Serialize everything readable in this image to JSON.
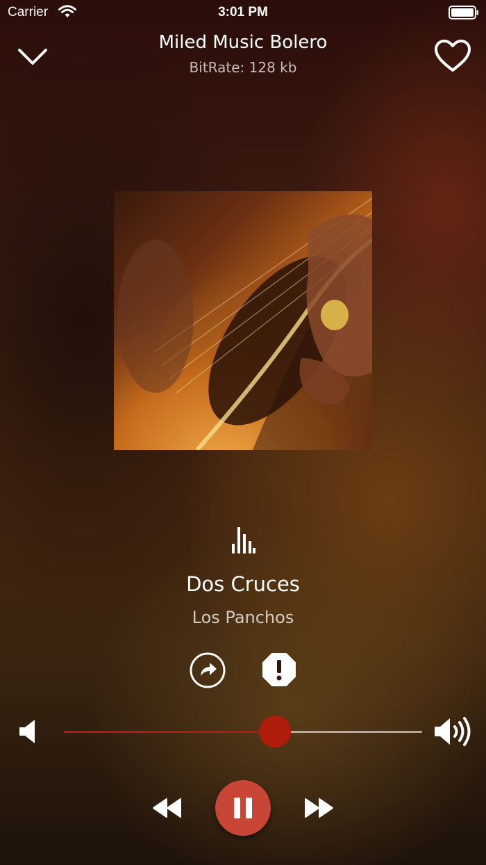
{
  "status_bar": {
    "carrier": "Carrier",
    "time": "3:01 PM",
    "icons": [
      "wifi-icon",
      "battery-icon"
    ]
  },
  "header": {
    "station_name": "Miled Music Bolero",
    "bitrate": "BitRate: 128 kb",
    "icons": [
      "chevron-down-icon",
      "heart-icon"
    ]
  },
  "now_playing": {
    "title": "Dos Cruces",
    "artist": "Los Panchos",
    "icons": [
      "equalizer-icon",
      "share-icon",
      "report-icon"
    ]
  },
  "volume": {
    "level_fraction": 0.59,
    "icons": [
      "volume-low-icon",
      "volume-high-icon"
    ]
  },
  "controls": {
    "icons": [
      "rewind-icon",
      "pause-icon",
      "fast-forward-icon"
    ]
  },
  "colors": {
    "accent": "#c94636",
    "slider_fill": "#b01c10",
    "text": "#ffffff"
  }
}
